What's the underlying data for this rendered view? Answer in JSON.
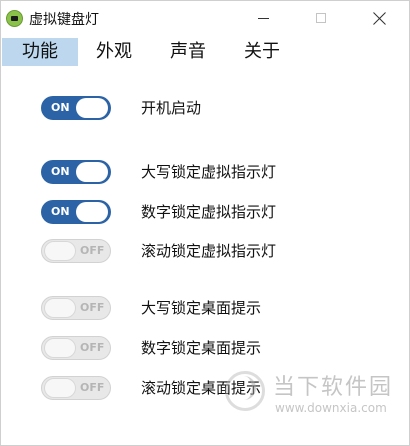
{
  "window": {
    "title": "虚拟键盘灯"
  },
  "menu": {
    "items": [
      "功能",
      "外观",
      "声音",
      "关于"
    ],
    "active": 0
  },
  "toggles": [
    {
      "state": "ON",
      "label": "开机启动"
    },
    {
      "state": "ON",
      "label": "大写锁定虚拟指示灯"
    },
    {
      "state": "ON",
      "label": "数字锁定虚拟指示灯"
    },
    {
      "state": "OFF",
      "label": "滚动锁定虚拟指示灯"
    },
    {
      "state": "OFF",
      "label": "大写锁定桌面提示"
    },
    {
      "state": "OFF",
      "label": "数字锁定桌面提示"
    },
    {
      "state": "OFF",
      "label": "滚动锁定桌面提示"
    }
  ],
  "colors": {
    "toggle_on": "#2b63a6",
    "toggle_off": "#e8e8e8",
    "menu_active": "#bcd7ee",
    "app_icon": "#8bc34a"
  },
  "icons": {
    "app": "keyboard-light-app-icon",
    "minimize": "minimize-icon",
    "maximize": "maximize-icon",
    "close": "close-icon"
  },
  "watermark": {
    "name": "当下软件园",
    "url": "www.downxia.com"
  }
}
